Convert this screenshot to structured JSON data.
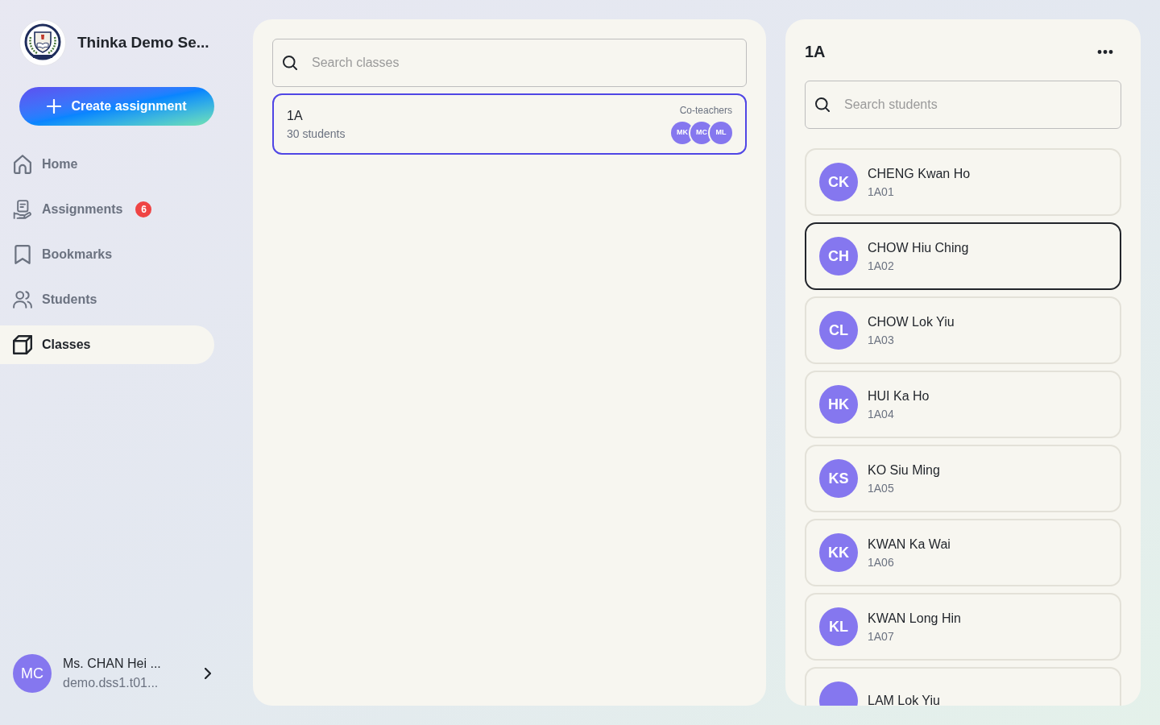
{
  "sidebar": {
    "school_name": "Thinka Demo Se...",
    "create_button": "Create assignment",
    "nav": [
      {
        "label": "Home",
        "selected": false
      },
      {
        "label": "Assignments",
        "selected": false,
        "badge": "6"
      },
      {
        "label": "Bookmarks",
        "selected": false
      },
      {
        "label": "Students",
        "selected": false
      },
      {
        "label": "Classes",
        "selected": true
      }
    ],
    "user": {
      "initials": "MC",
      "name": "Ms. CHAN Hei ...",
      "email": "demo.dss1.t01..."
    }
  },
  "classes_panel": {
    "search": {
      "placeholder": "Search classes"
    },
    "classes": [
      {
        "name": "1A",
        "count": "30 students",
        "selected": true,
        "co_teachers_label": "Co-teachers",
        "co_teachers": [
          "MK",
          "MC",
          "ML"
        ]
      }
    ]
  },
  "class_detail": {
    "title": "1A",
    "search": {
      "placeholder": "Search students"
    },
    "students": [
      {
        "initials": "CK",
        "name": "CHENG Kwan Ho",
        "id": "1A01",
        "selected": false
      },
      {
        "initials": "CH",
        "name": "CHOW Hiu Ching",
        "id": "1A02",
        "selected": true
      },
      {
        "initials": "CL",
        "name": "CHOW Lok Yiu",
        "id": "1A03",
        "selected": false
      },
      {
        "initials": "HK",
        "name": "HUI Ka Ho",
        "id": "1A04",
        "selected": false
      },
      {
        "initials": "KS",
        "name": "KO Siu Ming",
        "id": "1A05",
        "selected": false
      },
      {
        "initials": "KK",
        "name": "KWAN Ka Wai",
        "id": "1A06",
        "selected": false
      },
      {
        "initials": "KL",
        "name": "KWAN Long Hin",
        "id": "1A07",
        "selected": false
      },
      {
        "name": "LAM Lok Yiu",
        "selected": false
      }
    ]
  }
}
